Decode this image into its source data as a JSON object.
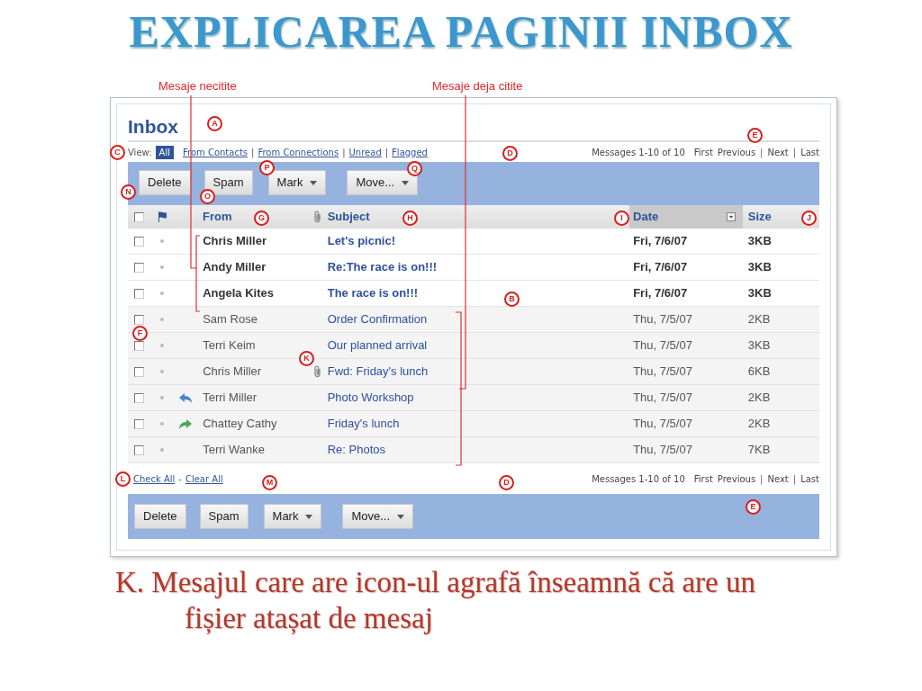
{
  "slide_title": "EXPLICAREA PAGINII INBOX",
  "annotations": [
    {
      "label": "Mesaje necitite"
    },
    {
      "label": "Mesaje deja citite"
    }
  ],
  "inbox": {
    "title": "Inbox",
    "view": {
      "label": "View:",
      "separator": "|",
      "filters": [
        {
          "label": "All",
          "selected": true
        },
        {
          "label": "From Contacts",
          "selected": false
        },
        {
          "label": "From Connections",
          "selected": false
        },
        {
          "label": "Unread",
          "selected": false
        },
        {
          "label": "Flagged",
          "selected": false
        }
      ]
    },
    "paging_top": {
      "count": "Messages 1-10 of 10",
      "separator": "|",
      "links": [
        "First",
        "Previous",
        "Next",
        "Last"
      ]
    },
    "toolbar_top": [
      {
        "label": "Delete",
        "dropdown": false
      },
      {
        "label": "Spam",
        "dropdown": false
      },
      {
        "label": "Mark",
        "dropdown": true
      },
      {
        "label": "Move...",
        "dropdown": true
      }
    ],
    "columns": {
      "select_all_checked": false,
      "from": "From",
      "subject": "Subject",
      "date": "Date",
      "size": "Size"
    },
    "rows": [
      {
        "from": "Chris Miller",
        "subject": "Let's picnic!",
        "date": "Fri, 7/6/07",
        "size": "3KB",
        "unread": true,
        "checked": false,
        "attachment": false,
        "replied": false,
        "forwarded": false
      },
      {
        "from": "Andy Miller",
        "subject": "Re:The race is on!!!",
        "date": "Fri, 7/6/07",
        "size": "3KB",
        "unread": true,
        "checked": false,
        "attachment": false,
        "replied": false,
        "forwarded": false
      },
      {
        "from": "Angela Kites",
        "subject": "The race is on!!!",
        "date": "Fri, 7/6/07",
        "size": "3KB",
        "unread": true,
        "checked": false,
        "attachment": false,
        "replied": false,
        "forwarded": false
      },
      {
        "from": "Sam Rose",
        "subject": "Order Confirmation",
        "date": "Thu, 7/5/07",
        "size": "2KB",
        "unread": false,
        "checked": false,
        "attachment": false,
        "replied": false,
        "forwarded": false
      },
      {
        "from": "Terri Keim",
        "subject": "Our planned arrival",
        "date": "Thu, 7/5/07",
        "size": "3KB",
        "unread": false,
        "checked": false,
        "attachment": false,
        "replied": false,
        "forwarded": false
      },
      {
        "from": "Chris Miller",
        "subject": "Fwd: Friday's lunch",
        "date": "Thu, 7/5/07",
        "size": "6KB",
        "unread": false,
        "checked": false,
        "attachment": true,
        "replied": false,
        "forwarded": false
      },
      {
        "from": "Terri Miller",
        "subject": "Photo Workshop",
        "date": "Thu, 7/5/07",
        "size": "2KB",
        "unread": false,
        "checked": false,
        "attachment": false,
        "replied": true,
        "forwarded": false
      },
      {
        "from": "Chattey Cathy",
        "subject": "Friday's lunch",
        "date": "Thu, 7/5/07",
        "size": "2KB",
        "unread": false,
        "checked": false,
        "attachment": false,
        "replied": false,
        "forwarded": true
      },
      {
        "from": "Terri Wanke",
        "subject": "Re: Photos",
        "date": "Thu, 7/5/07",
        "size": "7KB",
        "unread": false,
        "checked": false,
        "attachment": false,
        "replied": false,
        "forwarded": false
      }
    ],
    "footer": {
      "check_all": "Check All",
      "separator": "-",
      "clear_all": "Clear All"
    },
    "paging_bottom": {
      "count": "Messages 1-10 of 10",
      "separator": "|",
      "links": [
        "First",
        "Previous",
        "Next",
        "Last"
      ]
    },
    "toolbar_bottom": [
      {
        "label": "Delete",
        "dropdown": false
      },
      {
        "label": "Spam",
        "dropdown": false
      },
      {
        "label": "Mark",
        "dropdown": true
      },
      {
        "label": "Move...",
        "dropdown": true
      }
    ]
  },
  "callouts": [
    {
      "letter": "A"
    },
    {
      "letter": "E"
    },
    {
      "letter": "C"
    },
    {
      "letter": "D"
    },
    {
      "letter": "P"
    },
    {
      "letter": "Q"
    },
    {
      "letter": "N"
    },
    {
      "letter": "O"
    },
    {
      "letter": "G"
    },
    {
      "letter": "H"
    },
    {
      "letter": "I"
    },
    {
      "letter": "J"
    },
    {
      "letter": "B"
    },
    {
      "letter": "F"
    },
    {
      "letter": "K"
    },
    {
      "letter": "L"
    },
    {
      "letter": "M"
    },
    {
      "letter": "D"
    },
    {
      "letter": "E"
    }
  ],
  "caption": {
    "line_1": "K. Mesajul care are icon-ul agrafă înseamnă că are un",
    "line_2": "fișier atașat de mesaj"
  }
}
